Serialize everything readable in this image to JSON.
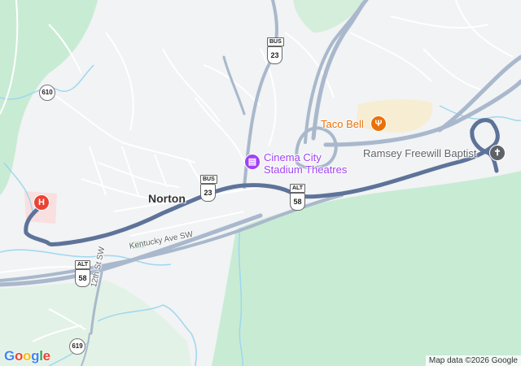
{
  "map": {
    "place_label": "Norton",
    "pois": {
      "cinema": {
        "label_line1": "Cinema City",
        "label_line2": "Stadium Theatres",
        "icon": "film-icon",
        "color": "#a142f4"
      },
      "taco_bell": {
        "label": "Taco Bell",
        "icon": "fork-knife-icon",
        "color": "#e8710a"
      },
      "church": {
        "label": "Ramsey Freewill Baptist",
        "icon": "church-icon",
        "color": "#5f6368"
      },
      "hospital": {
        "icon_text": "H",
        "icon": "hospital-icon",
        "color": "#ea4335"
      }
    },
    "streets": {
      "kentucky_ave": "Kentucky Ave SW",
      "twelfth_st": "12th St SW"
    },
    "shields": {
      "bus_top": {
        "tag": "BUS",
        "number": "23"
      },
      "bus_mid": {
        "tag": "BUS",
        "number": "23"
      },
      "alt_mid": {
        "tag": "ALT",
        "number": "58"
      },
      "alt_low": {
        "tag": "ALT",
        "number": "58"
      },
      "route_610": "610",
      "route_619": "619"
    },
    "colors": {
      "land": "#f1f3f4",
      "forest": "#c8ebd4",
      "water": "#9fd7ef",
      "route_highlight": "#5e7399",
      "highway": "#a9b8cc"
    }
  },
  "attribution": "Map data ©2026 Google",
  "logo": {
    "letters": [
      "G",
      "o",
      "o",
      "g",
      "l",
      "e"
    ],
    "colors": [
      "#4285f4",
      "#ea4335",
      "#fbbc05",
      "#4285f4",
      "#34a853",
      "#ea4335"
    ]
  }
}
